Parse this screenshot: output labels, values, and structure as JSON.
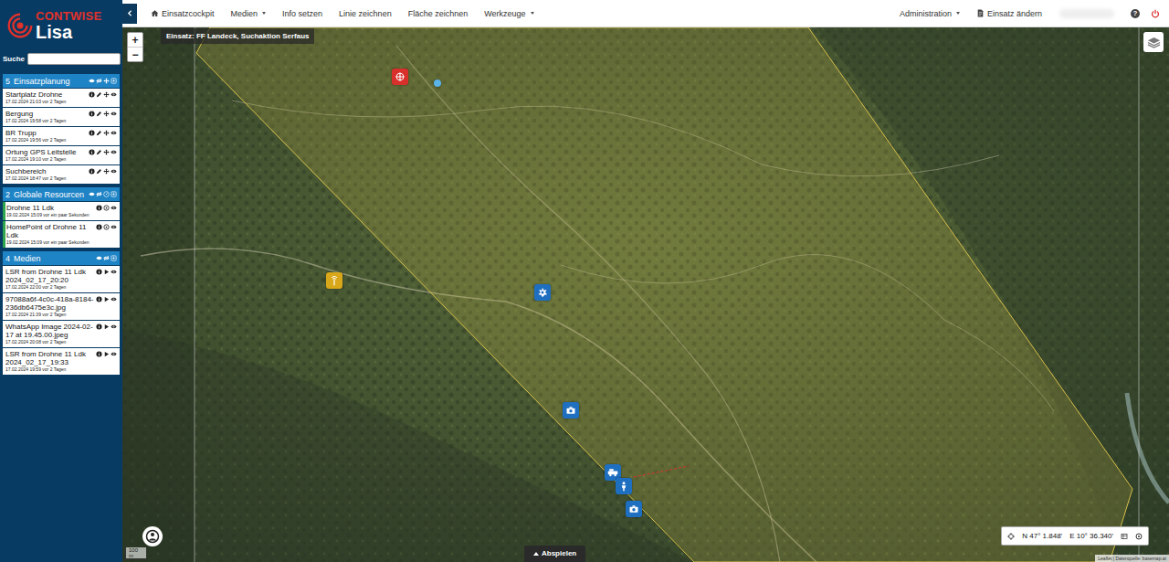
{
  "app": {
    "brand": "CONTWISE",
    "product": "Lisa"
  },
  "search": {
    "label": "Suche",
    "value": ""
  },
  "sections": [
    {
      "count": "5",
      "title": "Einsatzplanung",
      "kind": "plan",
      "items": [
        {
          "title": "Startplatz Drohne",
          "date": "17.02.2024 21:03 vor 2 Tagen",
          "active": false
        },
        {
          "title": "Bergung",
          "date": "17.02.2024 19:58 vor 2 Tagen",
          "active": false
        },
        {
          "title": "BR Trupp",
          "date": "17.02.2024 19:56 vor 2 Tagen",
          "active": false
        },
        {
          "title": "Ortung GPS Leitstelle",
          "date": "17.02.2024 19:10 vor 2 Tagen",
          "active": false
        },
        {
          "title": "Suchbereich",
          "date": "17.02.2024 18:47 vor 2 Tagen",
          "active": false
        }
      ]
    },
    {
      "count": "2",
      "title": "Globale Resourcen",
      "kind": "resource",
      "items": [
        {
          "title": "Drohne 11 Ldk",
          "date": "19.02.2024 15:09 vor ein paar Sekunden",
          "active": true
        },
        {
          "title": "HomePoint of Drohne 11 Ldk",
          "date": "19.02.2024 15:09 vor ein paar Sekunden",
          "active": true
        }
      ]
    },
    {
      "count": "4",
      "title": "Medien",
      "kind": "media",
      "items": [
        {
          "title": "LSR from Drohne 11 Ldk 2024_02_17_20:20",
          "date": "17.02.2024 22:00 vor 2 Tagen",
          "active": false
        },
        {
          "title": "97088a6f-4c0c-418a-8184-236db6475e3c.jpg",
          "date": "17.02.2024 21:39 vor 2 Tagen",
          "active": false
        },
        {
          "title": "WhatsApp Image 2024-02-17 at 19.45.00.jpeg",
          "date": "17.02.2024 20:08 vor 2 Tagen",
          "active": false
        },
        {
          "title": "LSR from Drohne 11 Ldk 2024_02_17_19:33",
          "date": "17.02.2024 19:59 vor 2 Tagen",
          "active": false
        }
      ]
    }
  ],
  "nav": {
    "left": [
      {
        "label": "Einsatzcockpit",
        "kind": "home"
      },
      {
        "label": "Medien",
        "kind": "dropdown"
      },
      {
        "label": "Info setzen",
        "kind": "plain"
      },
      {
        "label": "Linie zeichnen",
        "kind": "plain"
      },
      {
        "label": "Fläche zeichnen",
        "kind": "plain"
      },
      {
        "label": "Werkzeuge",
        "kind": "dropdown"
      }
    ],
    "right": [
      {
        "label": "Administration",
        "kind": "dropdown"
      },
      {
        "label": "Einsatz ändern",
        "kind": "doc"
      }
    ],
    "help": "?"
  },
  "map": {
    "title": "Einsatz: FF Landeck, Suchaktion Serfaus",
    "zoom_in": "+",
    "zoom_out": "−",
    "markers": [
      {
        "kind": "rescue",
        "color": "#d9302c"
      },
      {
        "kind": "dot",
        "color": "#5bb4e8"
      },
      {
        "kind": "antenna",
        "color": "#d9a81a"
      },
      {
        "kind": "team",
        "color": "#1f6fc0"
      },
      {
        "kind": "camera",
        "color": "#1f6fc0"
      },
      {
        "kind": "vehicle",
        "color": "#1f6fc0"
      },
      {
        "kind": "person",
        "color": "#1f6fc0"
      },
      {
        "kind": "camera",
        "color": "#1f6fc0"
      }
    ],
    "coords": {
      "lat": "N 47° 1.848'",
      "lon": "E 10° 36.340'"
    },
    "play": "Abspielen",
    "scale": "100 m",
    "attribution": "Leaflet | Datenquelle: basemap.at"
  }
}
